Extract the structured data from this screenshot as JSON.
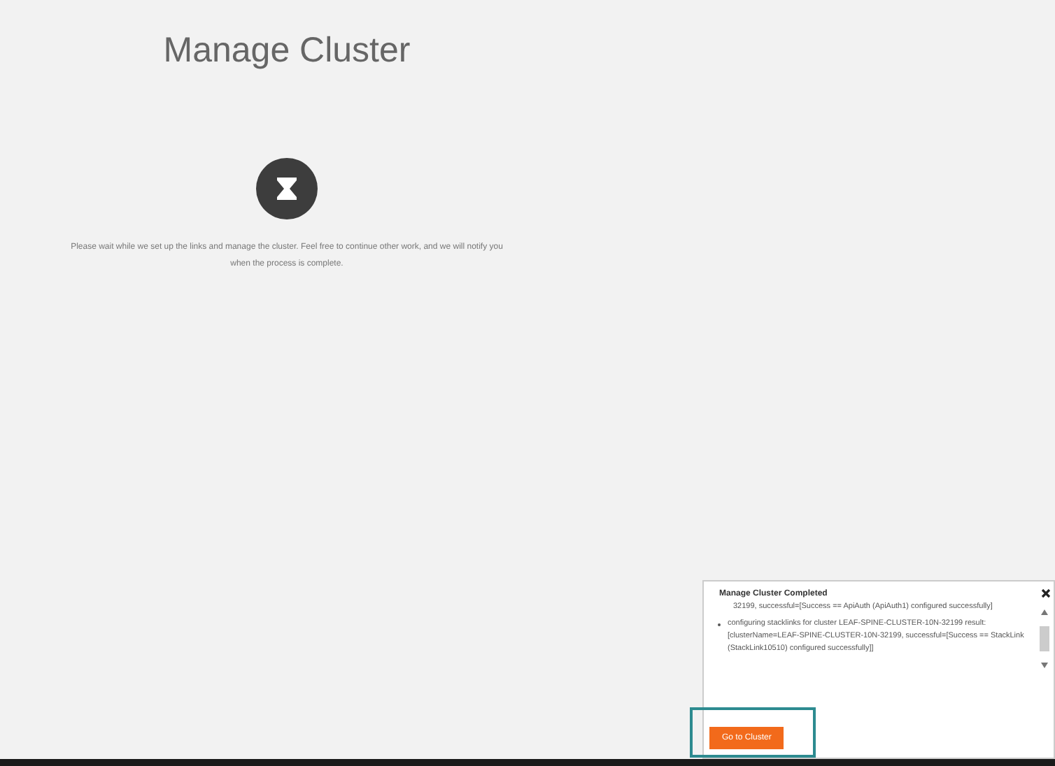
{
  "page": {
    "title": "Manage Cluster",
    "message": "Please wait while we set up the links and manage the cluster. Feel free to continue other work, and we will notify you when the process is complete."
  },
  "notification": {
    "title": "Manage Cluster Completed",
    "log": [
      {
        "kind": "continued",
        "text": "32199, successful=[Success == ApiAuth (ApiAuth1) configured successfully]"
      },
      {
        "kind": "bullet",
        "text": "configuring stacklinks for cluster LEAF-SPINE-CLUSTER-10N-32199 result: [clusterName=LEAF-SPINE-CLUSTER-10N-32199, successful=[Success == StackLink (StackLink10510) configured successfully]]"
      }
    ],
    "button": "Go to Cluster"
  }
}
